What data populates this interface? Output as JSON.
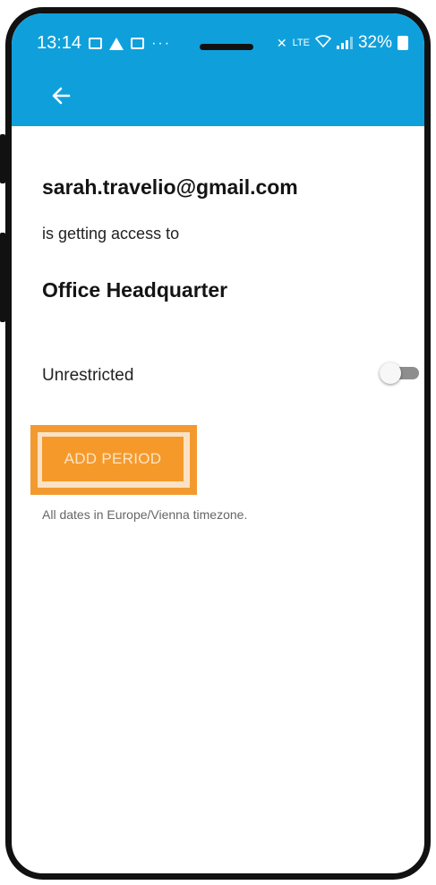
{
  "status_bar": {
    "time": "13:14",
    "battery": "32%",
    "network": "LTE"
  },
  "app_bar": {
    "back_icon": "arrow-left-icon"
  },
  "content": {
    "email": "sarah.travelio@gmail.com",
    "access_text": "is getting access to",
    "location": "Office Headquarter",
    "unrestricted_label": "Unrestricted",
    "unrestricted_on": false,
    "add_period_label": "ADD PERIOD",
    "timezone_note": "All dates in Europe/Vienna timezone."
  },
  "colors": {
    "app_bar": "#0fa0dc",
    "accent_button": "#f59a2a",
    "highlight": "#f29a2f"
  }
}
